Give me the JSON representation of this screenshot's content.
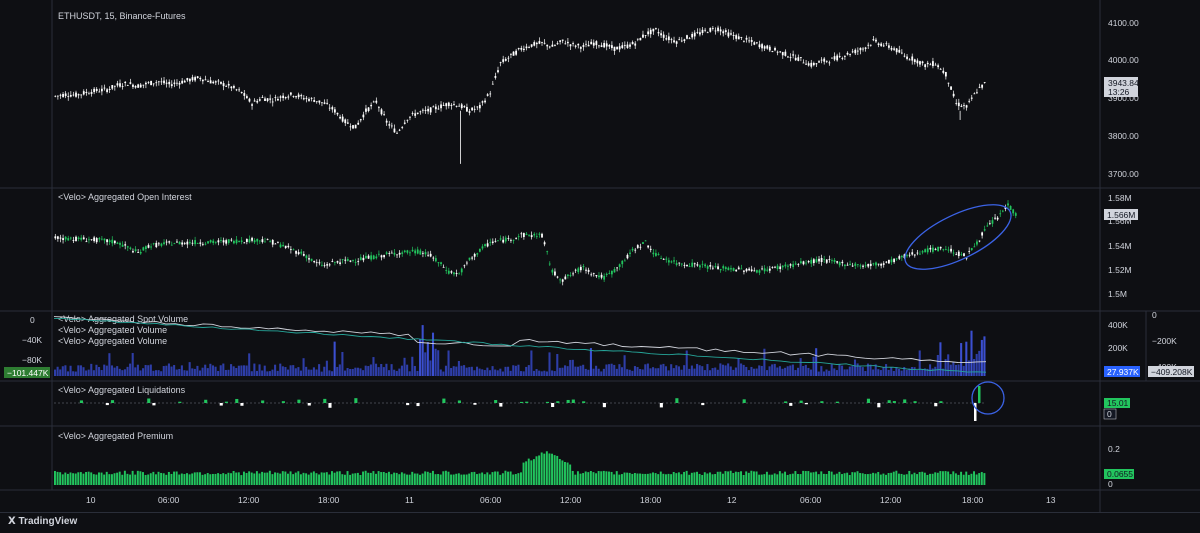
{
  "chart_data": {
    "type": "candlestick",
    "title": "ETHUSDT, 15, Binance-Futures",
    "symbol": "ETHUSDT",
    "interval": "15",
    "exchange": "Binance-Futures",
    "x_ticks": [
      "10",
      "06:00",
      "12:00",
      "18:00",
      "11",
      "06:00",
      "12:00",
      "18:00",
      "12",
      "06:00",
      "12:00",
      "18:00",
      "13"
    ],
    "panes": [
      {
        "name": "price",
        "series_name": "ETHUSDT",
        "y_ticks": [
          "4100.00",
          "4000.00",
          "3900.00",
          "3800.00",
          "3700.00"
        ],
        "ylim": [
          3660,
          4130
        ],
        "last_value": "3943.84",
        "countdown": "13:26",
        "path": [
          [
            0,
            3900
          ],
          [
            2,
            3905
          ],
          [
            4,
            3903
          ],
          [
            6,
            3910
          ],
          [
            8,
            3915
          ],
          [
            10,
            3918
          ],
          [
            12,
            3930
          ],
          [
            14,
            3935
          ],
          [
            16,
            3928
          ],
          [
            18,
            3935
          ],
          [
            20,
            3940
          ],
          [
            22,
            3932
          ],
          [
            24,
            3938
          ],
          [
            26,
            3945
          ],
          [
            28,
            3950
          ],
          [
            30,
            3940
          ],
          [
            32,
            3935
          ],
          [
            34,
            3925
          ],
          [
            36,
            3910
          ],
          [
            38,
            3880
          ],
          [
            40,
            3895
          ],
          [
            42,
            3890
          ],
          [
            44,
            3900
          ],
          [
            46,
            3905
          ],
          [
            48,
            3895
          ],
          [
            50,
            3890
          ],
          [
            52,
            3880
          ],
          [
            54,
            3860
          ],
          [
            56,
            3830
          ],
          [
            58,
            3815
          ],
          [
            60,
            3860
          ],
          [
            62,
            3885
          ],
          [
            64,
            3830
          ],
          [
            66,
            3800
          ],
          [
            68,
            3840
          ],
          [
            70,
            3855
          ],
          [
            72,
            3860
          ],
          [
            74,
            3870
          ],
          [
            76,
            3880
          ],
          [
            78,
            3875
          ],
          [
            80,
            3860
          ],
          [
            82,
            3870
          ],
          [
            84,
            3910
          ],
          [
            86,
            3990
          ],
          [
            88,
            4010
          ],
          [
            90,
            4030
          ],
          [
            92,
            4040
          ],
          [
            94,
            4045
          ],
          [
            96,
            4035
          ],
          [
            98,
            4050
          ],
          [
            100,
            4040
          ],
          [
            102,
            4035
          ],
          [
            104,
            4045
          ],
          [
            106,
            4040
          ],
          [
            108,
            4030
          ],
          [
            110,
            4035
          ],
          [
            112,
            4045
          ],
          [
            114,
            4070
          ],
          [
            116,
            4080
          ],
          [
            118,
            4060
          ],
          [
            120,
            4050
          ],
          [
            122,
            4060
          ],
          [
            124,
            4070
          ],
          [
            126,
            4080
          ],
          [
            128,
            4085
          ],
          [
            130,
            4070
          ],
          [
            132,
            4060
          ],
          [
            134,
            4050
          ],
          [
            136,
            4040
          ],
          [
            138,
            4030
          ],
          [
            140,
            4020
          ],
          [
            142,
            4010
          ],
          [
            144,
            4000
          ],
          [
            146,
            3985
          ],
          [
            148,
            3995
          ],
          [
            150,
            4000
          ],
          [
            152,
            4010
          ],
          [
            154,
            4020
          ],
          [
            156,
            4030
          ],
          [
            158,
            4050
          ],
          [
            160,
            4040
          ],
          [
            162,
            4030
          ],
          [
            164,
            4010
          ],
          [
            166,
            4000
          ],
          [
            168,
            3985
          ],
          [
            170,
            3990
          ],
          [
            172,
            3960
          ],
          [
            174,
            3880
          ],
          [
            176,
            3870
          ],
          [
            178,
            3915
          ],
          [
            180,
            3940
          ]
        ]
      },
      {
        "name": "Aggregated Open Interest",
        "label": "<Velo> Aggregated Open Interest",
        "y_ticks": [
          "1.58M",
          "1.56M",
          "1.54M",
          "1.52M",
          "1.5M"
        ],
        "ylim": [
          1.496,
          1.586
        ],
        "last_value": "1.566M",
        "path": [
          [
            0,
            1.549
          ],
          [
            4,
            1.548
          ],
          [
            8,
            1.547
          ],
          [
            12,
            1.545
          ],
          [
            16,
            1.536
          ],
          [
            18,
            1.542
          ],
          [
            22,
            1.544
          ],
          [
            26,
            1.545
          ],
          [
            30,
            1.545
          ],
          [
            34,
            1.546
          ],
          [
            38,
            1.547
          ],
          [
            40,
            1.547
          ],
          [
            42,
            1.545
          ],
          [
            44,
            1.542
          ],
          [
            46,
            1.538
          ],
          [
            48,
            1.535
          ],
          [
            50,
            1.528
          ],
          [
            52,
            1.525
          ],
          [
            54,
            1.528
          ],
          [
            58,
            1.53
          ],
          [
            62,
            1.533
          ],
          [
            66,
            1.536
          ],
          [
            70,
            1.537
          ],
          [
            72,
            1.535
          ],
          [
            74,
            1.528
          ],
          [
            76,
            1.52
          ],
          [
            78,
            1.518
          ],
          [
            80,
            1.53
          ],
          [
            82,
            1.538
          ],
          [
            84,
            1.545
          ],
          [
            88,
            1.548
          ],
          [
            90,
            1.551
          ],
          [
            94,
            1.551
          ],
          [
            96,
            1.52
          ],
          [
            98,
            1.513
          ],
          [
            102,
            1.524
          ],
          [
            104,
            1.518
          ],
          [
            106,
            1.515
          ],
          [
            108,
            1.521
          ],
          [
            110,
            1.53
          ],
          [
            112,
            1.54
          ],
          [
            114,
            1.545
          ],
          [
            116,
            1.534
          ],
          [
            120,
            1.527
          ],
          [
            124,
            1.526
          ],
          [
            128,
            1.523
          ],
          [
            132,
            1.522
          ],
          [
            136,
            1.521
          ],
          [
            140,
            1.524
          ],
          [
            144,
            1.527
          ],
          [
            148,
            1.53
          ],
          [
            152,
            1.527
          ],
          [
            156,
            1.525
          ],
          [
            160,
            1.527
          ],
          [
            164,
            1.533
          ],
          [
            168,
            1.538
          ],
          [
            172,
            1.54
          ],
          [
            174,
            1.536
          ],
          [
            176,
            1.533
          ],
          [
            178,
            1.545
          ],
          [
            180,
            1.558
          ],
          [
            182,
            1.566
          ],
          [
            184,
            1.577
          ],
          [
            186,
            1.566
          ]
        ]
      },
      {
        "name": "volume",
        "labels": [
          "<Velo> Aggregated Spot Volume",
          "<Velo> Aggregated Volume",
          "<Velo> Aggregated Volume"
        ],
        "left_ticks": [
          "0",
          "−40K",
          "−80K"
        ],
        "right_ticks": [
          "400K",
          "200K"
        ],
        "far_right_ticks": [
          "0",
          "−200K",
          "−400K"
        ],
        "left_value": "−101.447K",
        "right_value": "27.937K",
        "far_right_value": "−409.208K"
      },
      {
        "name": "Aggregated Liquidations",
        "label": "<Velo> Aggregated Liquidations",
        "last_value": "15.01",
        "zero_label": "0"
      },
      {
        "name": "Aggregated Premium",
        "label": "<Velo> Aggregated Premium",
        "y_ticks": [
          "0.2",
          "0"
        ],
        "last_value": "0.0655"
      }
    ],
    "colors": {
      "up": "#26a69a",
      "down": "#ffffff",
      "oi_up": "#22c55e",
      "volume_bar": "#2e3ea8",
      "volume_bar_hi": "#3b4fd0",
      "premium_bar": "#22c55e",
      "spot_line": "#d1d4dc",
      "agg_line": "#26a69a",
      "annotation": "#3b63e6",
      "price_label_bg": "#d1d4dc",
      "oi_label_bg": "#d1d4dc",
      "vol_label_bg": "#2962ff",
      "liq_label_bg": "#22c55e",
      "premium_label_bg": "#22c55e"
    }
  },
  "footer": {
    "brand": "TradingView"
  }
}
